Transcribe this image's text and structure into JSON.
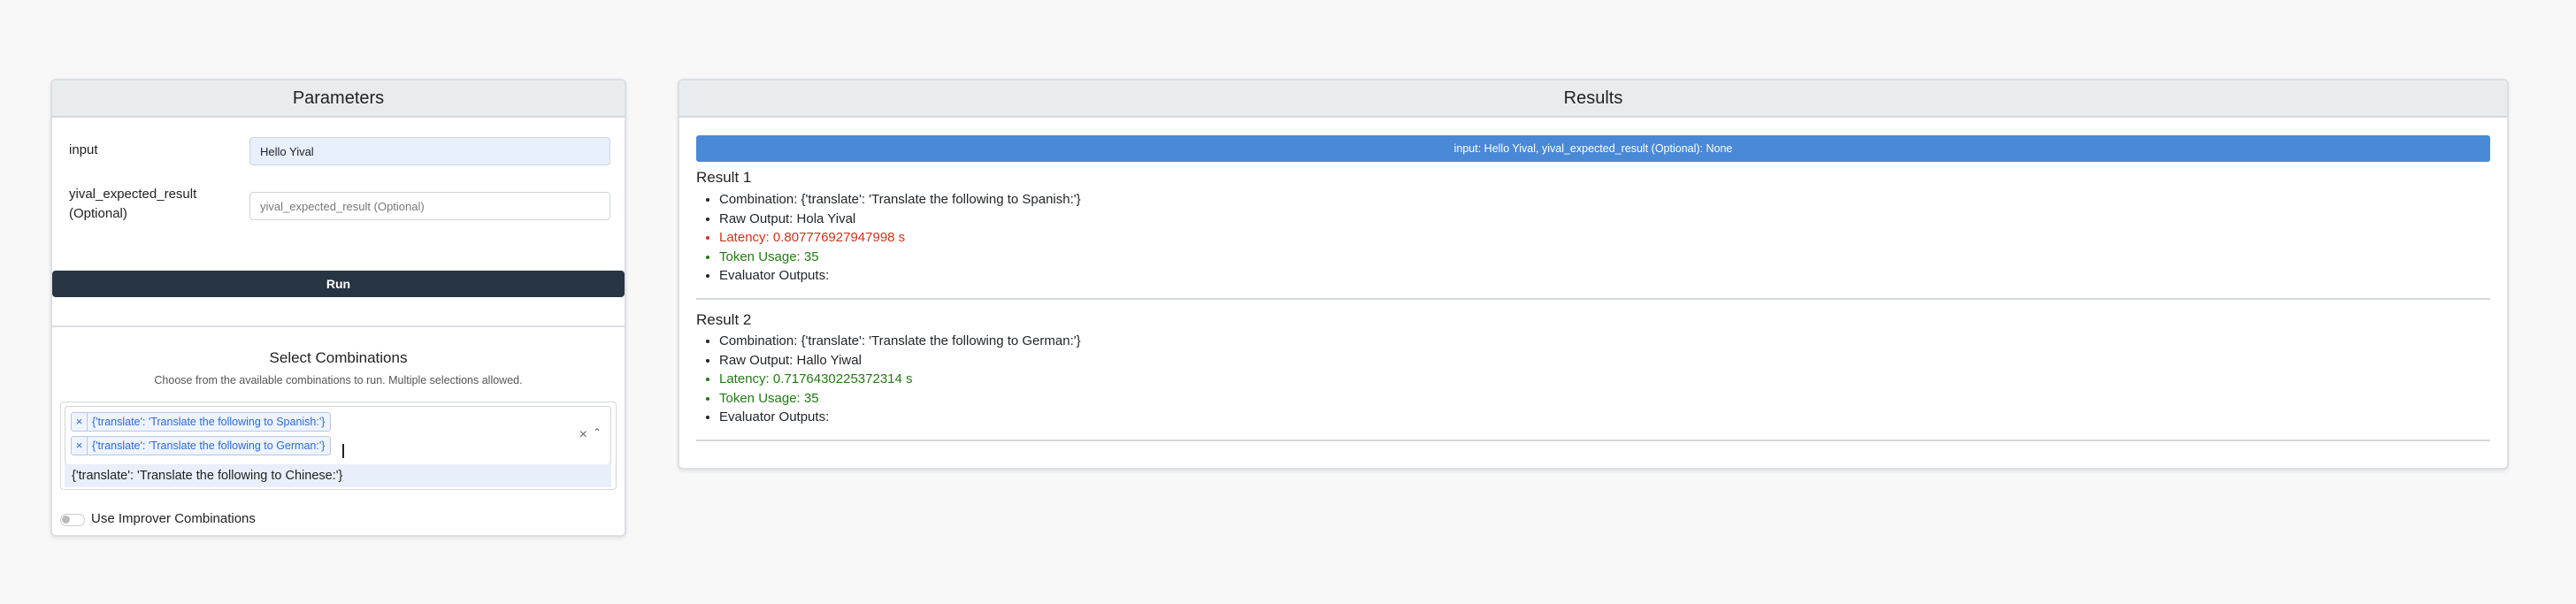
{
  "parameters": {
    "title": "Parameters",
    "input_label": "input",
    "input_value": "Hello Yival",
    "expected_label": "yival_expected_result (Optional)",
    "expected_placeholder": "yival_expected_result (Optional)",
    "run_label": "Run"
  },
  "combinations": {
    "title": "Select Combinations",
    "subtitle": "Choose from the available combinations to run. Multiple selections allowed.",
    "selected": [
      "{'translate': 'Translate the following to Spanish:'}",
      "{'translate': 'Translate the following to German:'}"
    ],
    "tag_remove_symbol": "×",
    "clear_symbol": "×",
    "dropdown_symbol": "⌃",
    "options": [
      "{'translate': 'Translate the following to Chinese:'}"
    ],
    "improver_label": "Use Improver Combinations"
  },
  "results": {
    "title": "Results",
    "input_banner": "input: Hello Yival, yival_expected_result (Optional): None",
    "items": [
      {
        "title": "Result 1",
        "combination": "Combination: {'translate': 'Translate the following to Spanish:'}",
        "raw_output": "Raw Output: Hola Yival",
        "latency": "Latency: 0.807776927947998 s",
        "token_usage": "Token Usage: 35",
        "evaluator": "Evaluator Outputs:"
      },
      {
        "title": "Result 2",
        "combination": "Combination: {'translate': 'Translate the following to German:'}",
        "raw_output": "Raw Output: Hallo Yiwal",
        "latency": "Latency: 0.7176430225372314 s",
        "token_usage": "Token Usage: 35",
        "evaluator": "Evaluator Outputs:"
      }
    ]
  },
  "colors": {
    "run_button": "#273543",
    "banner": "#4a89d6",
    "latency_slow": "#d0311a",
    "latency_fast": "#217a13",
    "token_usage": "#217a13"
  }
}
